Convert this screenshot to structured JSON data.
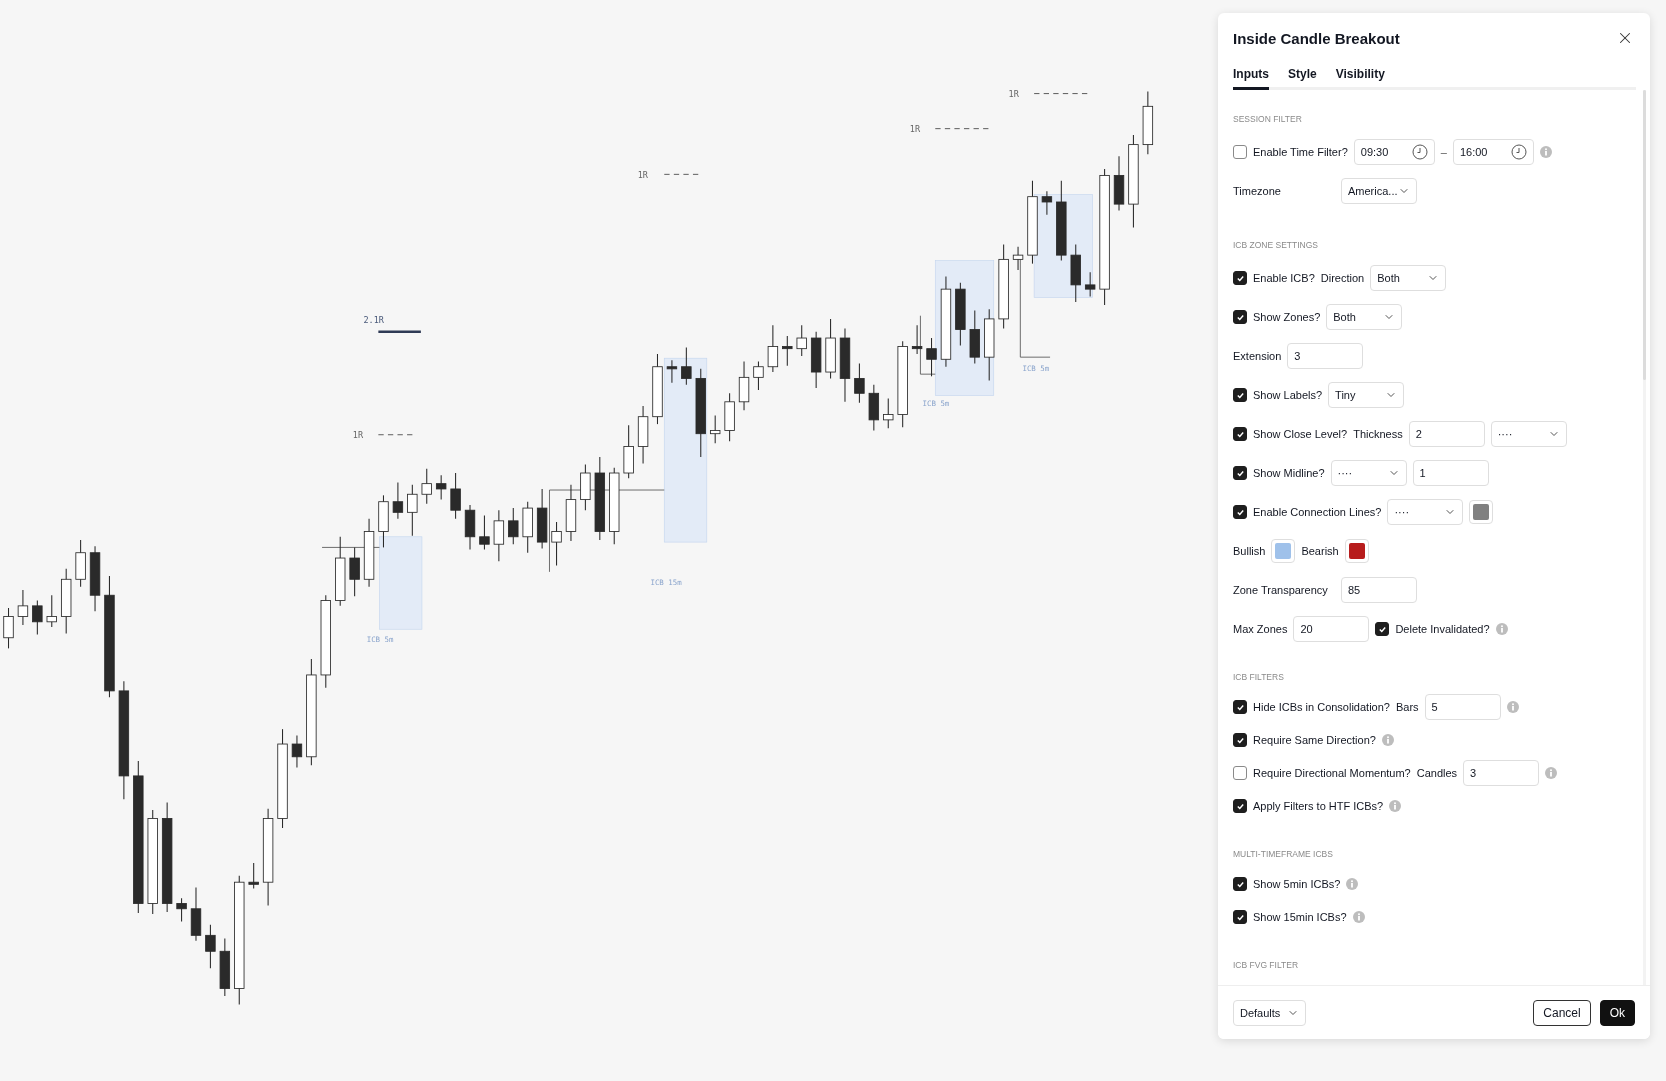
{
  "chart": {
    "levels": [
      {
        "text": "1R",
        "kind": "dashed"
      },
      {
        "text": "1R",
        "kind": "dashed"
      },
      {
        "text": "1R",
        "kind": "dashed"
      },
      {
        "text": "2.1R",
        "kind": "solid"
      },
      {
        "text": "1R",
        "kind": "dashed"
      }
    ],
    "zones": [
      {
        "label": "ICB 5m"
      },
      {
        "label": "ICB 5m"
      },
      {
        "label": "ICB 15m"
      },
      {
        "label": "ICB 5m"
      }
    ]
  },
  "dialog": {
    "title": "Inside Candle Breakout",
    "tabs": [
      {
        "label": "Inputs",
        "selected": true
      },
      {
        "label": "Style",
        "selected": false
      },
      {
        "label": "Visibility",
        "selected": false
      }
    ],
    "sections": [
      {
        "title": "SESSION FILTER",
        "rows": [
          {
            "kind": "inline",
            "parts": [
              {
                "kind": "check",
                "label": "Enable Time Filter?",
                "checked": false
              },
              {
                "kind": "time",
                "value": "09:30"
              },
              {
                "kind": "sep",
                "text": "–"
              },
              {
                "kind": "time",
                "value": "16:00"
              },
              {
                "kind": "info"
              }
            ]
          },
          {
            "kind": "aligned",
            "parts": [
              {
                "kind": "text",
                "text": "Timezone"
              },
              {
                "kind": "select",
                "value": "America..."
              }
            ]
          }
        ]
      },
      {
        "title": "ICB ZONE SETTINGS",
        "rows": [
          {
            "kind": "inline",
            "parts": [
              {
                "kind": "check",
                "label": "Enable ICB?",
                "checked": true
              },
              {
                "kind": "text",
                "text": "Direction"
              },
              {
                "kind": "select",
                "value": "Both"
              }
            ]
          },
          {
            "kind": "inline",
            "parts": [
              {
                "kind": "check",
                "label": "Show Zones?",
                "checked": true
              },
              {
                "kind": "select",
                "value": "Both"
              }
            ]
          },
          {
            "kind": "inline",
            "parts": [
              {
                "kind": "text",
                "text": "Extension"
              },
              {
                "kind": "input",
                "value": "3"
              }
            ]
          },
          {
            "kind": "inline",
            "parts": [
              {
                "kind": "check",
                "label": "Show Labels?",
                "checked": true
              },
              {
                "kind": "select",
                "value": "Tiny"
              }
            ]
          },
          {
            "kind": "inline",
            "parts": [
              {
                "kind": "check",
                "label": "Show Close Level?",
                "checked": true
              },
              {
                "kind": "text",
                "text": "Thickness"
              },
              {
                "kind": "input",
                "value": "2"
              },
              {
                "kind": "select",
                "value": "····"
              }
            ]
          },
          {
            "kind": "inline",
            "parts": [
              {
                "kind": "check",
                "label": "Show Midline?",
                "checked": true
              },
              {
                "kind": "select",
                "value": "····"
              },
              {
                "kind": "input",
                "value": "1"
              }
            ]
          },
          {
            "kind": "inline",
            "parts": [
              {
                "kind": "check",
                "label": "Enable Connection Lines?",
                "checked": true
              },
              {
                "kind": "select",
                "value": "····"
              },
              {
                "kind": "swatch",
                "color": "#808080"
              }
            ]
          },
          {
            "kind": "inline",
            "parts": [
              {
                "kind": "text",
                "text": "Bullish"
              },
              {
                "kind": "swatch",
                "color": "#9fc1ea"
              },
              {
                "kind": "text",
                "text": "Bearish"
              },
              {
                "kind": "swatch",
                "color": "#b71c1c"
              }
            ]
          },
          {
            "kind": "aligned",
            "parts": [
              {
                "kind": "text",
                "text": "Zone Transparency"
              },
              {
                "kind": "input",
                "value": "85"
              }
            ]
          },
          {
            "kind": "inline",
            "parts": [
              {
                "kind": "text",
                "text": "Max Zones"
              },
              {
                "kind": "input",
                "value": "20"
              },
              {
                "kind": "check",
                "label": "Delete Invalidated?",
                "checked": true
              },
              {
                "kind": "info"
              }
            ]
          }
        ]
      },
      {
        "title": "ICB FILTERS",
        "rows": [
          {
            "kind": "inline",
            "parts": [
              {
                "kind": "check",
                "label": "Hide ICBs in Consolidation?",
                "checked": true
              },
              {
                "kind": "text",
                "text": "Bars"
              },
              {
                "kind": "input",
                "value": "5"
              },
              {
                "kind": "info"
              }
            ]
          },
          {
            "kind": "inline",
            "parts": [
              {
                "kind": "check",
                "label": "Require Same Direction?",
                "checked": true
              },
              {
                "kind": "info"
              }
            ]
          },
          {
            "kind": "inline",
            "parts": [
              {
                "kind": "check",
                "label": "Require Directional Momentum?",
                "checked": false
              },
              {
                "kind": "text",
                "text": "Candles"
              },
              {
                "kind": "input",
                "value": "3"
              },
              {
                "kind": "info"
              }
            ]
          },
          {
            "kind": "inline",
            "parts": [
              {
                "kind": "check",
                "label": "Apply Filters to HTF ICBs?",
                "checked": true
              },
              {
                "kind": "info"
              }
            ]
          }
        ]
      },
      {
        "title": "MULTI-TIMEFRAME ICBS",
        "rows": [
          {
            "kind": "inline",
            "parts": [
              {
                "kind": "check",
                "label": "Show 5min ICBs?",
                "checked": true
              },
              {
                "kind": "info"
              }
            ]
          },
          {
            "kind": "inline",
            "parts": [
              {
                "kind": "check",
                "label": "Show 15min ICBs?",
                "checked": true
              },
              {
                "kind": "info"
              }
            ]
          }
        ]
      },
      {
        "title": "ICB FVG FILTER"
      }
    ],
    "footer": {
      "preset": "Defaults",
      "buttons": [
        {
          "label": "Cancel",
          "kind": "secondary"
        },
        {
          "label": "Ok",
          "kind": "primary"
        }
      ]
    }
  }
}
